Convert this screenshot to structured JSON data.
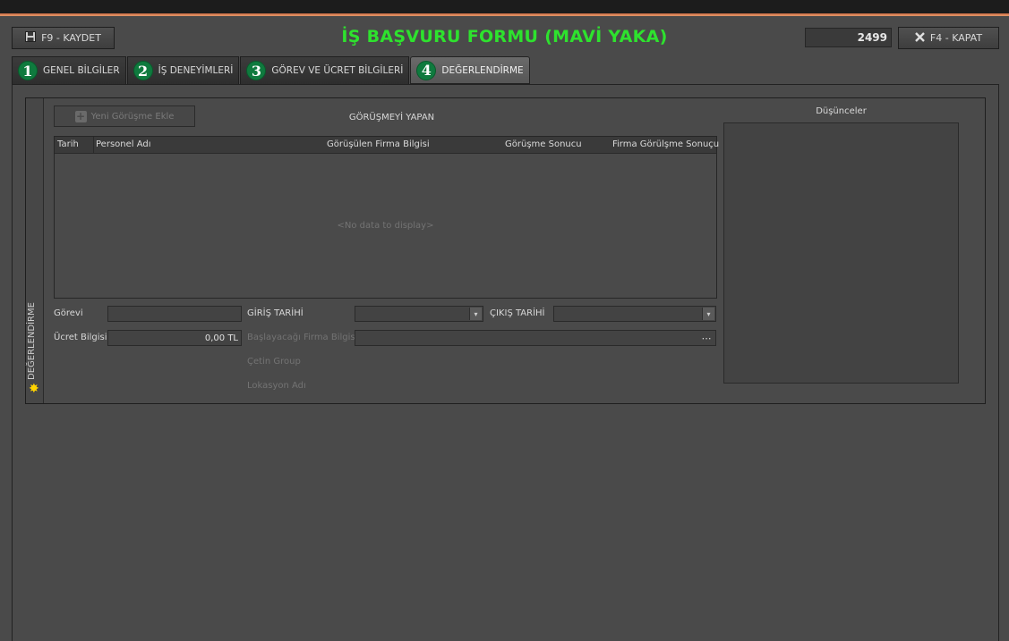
{
  "toolbar": {
    "save_label": "F9 - KAYDET",
    "save_icon": "floppy-disk-icon",
    "close_label": "F4 - KAPAT",
    "close_icon": "x-icon",
    "record_number": "2499"
  },
  "header": {
    "title": "İŞ BAŞVURU FORMU (MAVİ YAKA)",
    "title_color": "#2ee22e"
  },
  "tabs": [
    {
      "number": "1",
      "label": "GENEL BİLGİLER"
    },
    {
      "number": "2",
      "label": "İŞ DENEYİMLERİ"
    },
    {
      "number": "3",
      "label": "GÖREV VE ÜCRET BİLGİLERİ"
    },
    {
      "number": "4",
      "label": "DEĞERLENDİRME",
      "active": true
    }
  ],
  "badge_color": "#0f7a3e",
  "section": {
    "side_label": "DEĞERLENDİRME",
    "add_button": "Yeni Görüşme Ekle",
    "grid_caption": "GÖRÜŞMEYİ YAPAN",
    "grid_columns": [
      "Tarih",
      "Personel Adı",
      "Görüşülen Firma Bilgisi",
      "Görüşme Sonucu",
      "Firma Görülşme Sonuçu"
    ],
    "grid_empty": "<No data to display>",
    "notes_label": "Düşünceler"
  },
  "form": {
    "gorevi_label": "Görevi",
    "gorevi_value": "",
    "ucret_label": "Ücret Bilgisi",
    "ucret_value": "0,00 TL",
    "giris_label": "GİRİŞ TARİHİ",
    "giris_value": "",
    "cikis_label": "ÇIKIŞ TARİHİ",
    "cikis_value": "",
    "firma_label": "Başlayacağı Firma Bilgisi",
    "firma_value": "",
    "group_label": "Çetin Group",
    "lokasyon_label": "Lokasyon Adı"
  }
}
